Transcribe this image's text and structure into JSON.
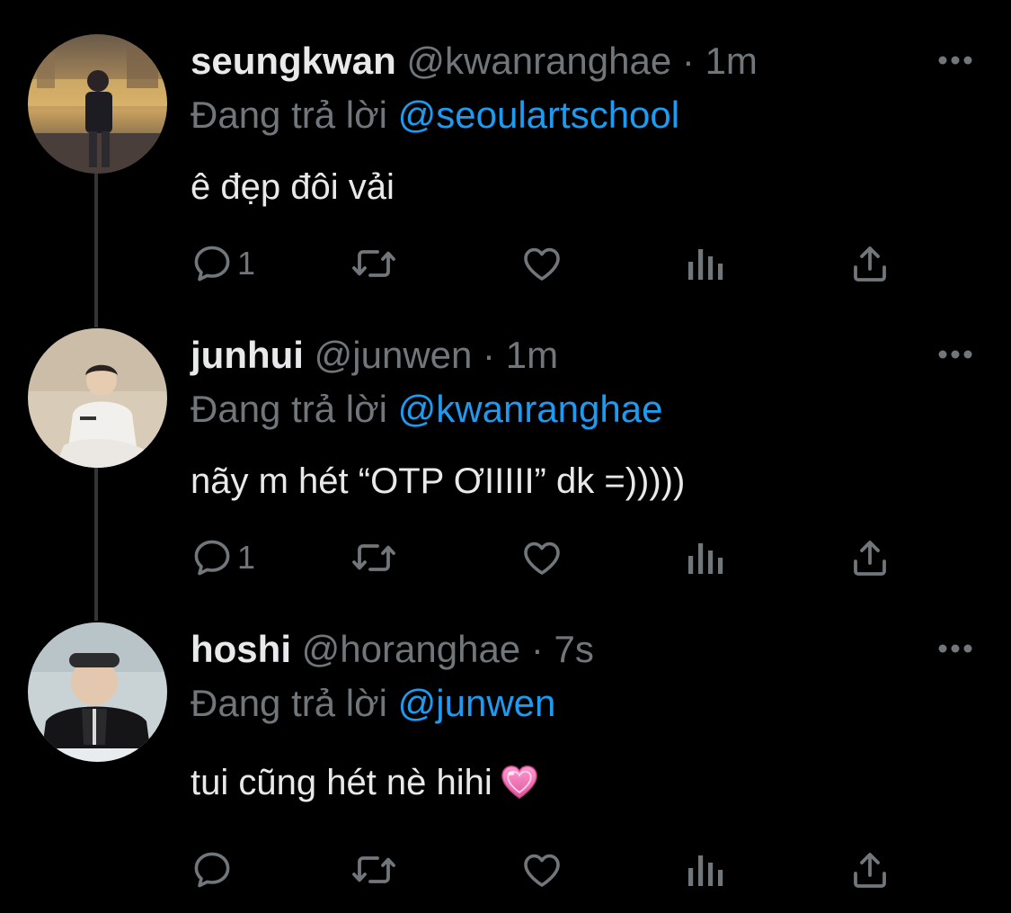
{
  "tweets": [
    {
      "display_name": "seungkwan",
      "handle": "@kwanranghae",
      "separator": "·",
      "time": "1m",
      "reply_prefix": "Đang trả lời",
      "reply_mention": "@seoulartschool",
      "text": "ê đẹp đôi vải",
      "reply_count": "1"
    },
    {
      "display_name": "junhui",
      "handle": "@junwen",
      "separator": "·",
      "time": "1m",
      "reply_prefix": "Đang trả lời",
      "reply_mention": "@kwanranghae",
      "text": "nãy m hét “OTP ƠIIIII” dk =)))))",
      "reply_count": "1"
    },
    {
      "display_name": "hoshi",
      "handle": "@horanghae",
      "separator": "·",
      "time": "7s",
      "reply_prefix": "Đang trả lời",
      "reply_mention": "@junwen",
      "text": "tui cũng hét nè hihi",
      "reply_count": ""
    }
  ],
  "icons": {
    "more": "more-horizontal-icon",
    "reply": "reply-bubble-icon",
    "retweet": "retweet-icon",
    "like": "heart-icon",
    "views": "views-bar-chart-icon",
    "share": "share-upload-icon",
    "emoji": "pink-heart-emoji"
  },
  "colors": {
    "background": "#000000",
    "primary_text": "#e7e9ea",
    "secondary_text": "#71767b",
    "mention": "#1d9bf0",
    "thread_line": "#333639"
  }
}
